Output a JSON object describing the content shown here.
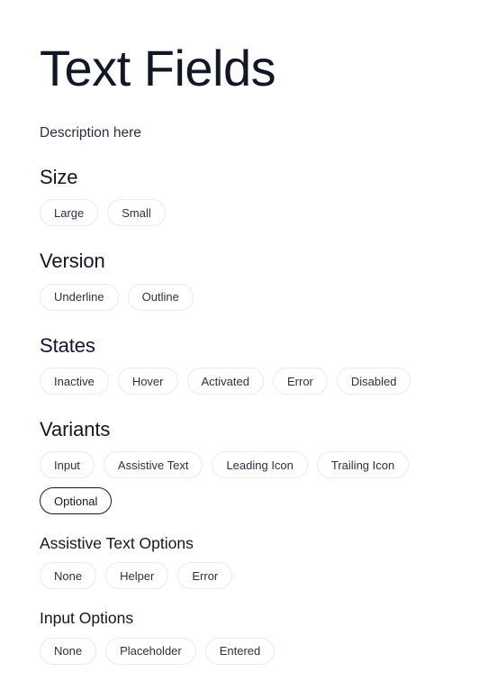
{
  "page": {
    "title": "Text Fields",
    "description": "Description here"
  },
  "colors": {
    "background": "#ffffff",
    "text": "#1d2233",
    "title": "#121726",
    "chip_border": "#e9e9ee",
    "chip_border_selected": "#14192b",
    "chip_text": "#2c3142"
  },
  "sections": [
    {
      "id": "size",
      "level": "h2",
      "title": "Size",
      "options": [
        {
          "label": "Large",
          "selected": false
        },
        {
          "label": "Small",
          "selected": false
        }
      ]
    },
    {
      "id": "version",
      "level": "h2",
      "title": "Version",
      "options": [
        {
          "label": "Underline",
          "selected": false
        },
        {
          "label": "Outline",
          "selected": false
        }
      ]
    },
    {
      "id": "states",
      "level": "h2",
      "title": "States",
      "options": [
        {
          "label": "Inactive",
          "selected": false
        },
        {
          "label": "Hover",
          "selected": false
        },
        {
          "label": "Activated",
          "selected": false
        },
        {
          "label": "Error",
          "selected": false
        },
        {
          "label": "Disabled",
          "selected": false
        }
      ]
    },
    {
      "id": "variants",
      "level": "h2",
      "title": "Variants",
      "options": [
        {
          "label": "Input",
          "selected": false
        },
        {
          "label": "Assistive Text",
          "selected": false
        },
        {
          "label": "Leading Icon",
          "selected": false
        },
        {
          "label": "Trailing Icon",
          "selected": false
        },
        {
          "label": "Optional",
          "selected": true
        }
      ]
    },
    {
      "id": "assistive-text-options",
      "level": "h3",
      "title": "Assistive Text Options",
      "options": [
        {
          "label": "None",
          "selected": false
        },
        {
          "label": "Helper",
          "selected": false
        },
        {
          "label": "Error",
          "selected": false
        }
      ]
    },
    {
      "id": "input-options",
      "level": "h3",
      "title": "Input Options",
      "options": [
        {
          "label": "None",
          "selected": false
        },
        {
          "label": "Placeholder",
          "selected": false
        },
        {
          "label": "Entered",
          "selected": false
        }
      ]
    }
  ]
}
